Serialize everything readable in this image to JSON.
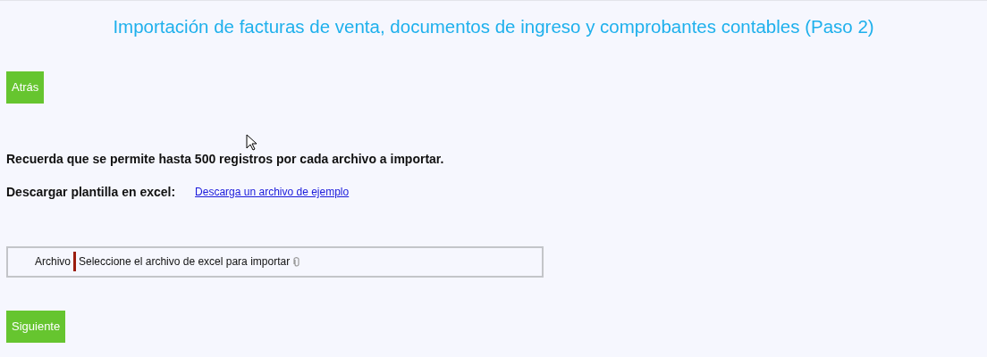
{
  "title": "Importación de facturas de venta, documentos de ingreso y comprobantes contables (Paso 2)",
  "back_button": "Atrás",
  "notice": "Recuerda que se permite hasta 500 registros por cada archivo a importar.",
  "template": {
    "label": "Descargar plantilla en excel:",
    "link": "Descarga un archivo de ejemplo"
  },
  "file_field": {
    "label": "Archivo",
    "placeholder": "Seleccione el archivo de excel para importar"
  },
  "next_button": "Siguiente"
}
